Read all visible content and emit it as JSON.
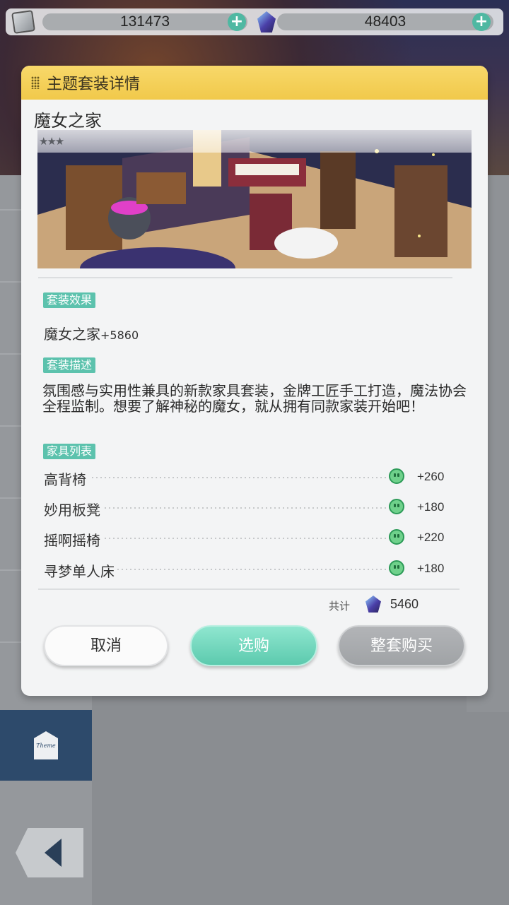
{
  "currency": {
    "coins": "131473",
    "crystals": "48403",
    "add_symbol": "+"
  },
  "dialog": {
    "title": "主题套装详情",
    "set_name": "魔女之家",
    "stars": "★★★",
    "sections": {
      "effect": "套装效果",
      "description": "套装描述",
      "furniture": "家具列表"
    },
    "effect": {
      "name": "魔女之家",
      "value": "+5860"
    },
    "description": "氛围感与实用性兼具的新款家具套装，金牌工匠手工打造，魔法协会全程监制。想要了解神秘的魔女，就从拥有同款家装开始吧！",
    "furniture": [
      {
        "name": "高背椅",
        "value": "+260"
      },
      {
        "name": "妙用板凳",
        "value": "+180"
      },
      {
        "name": "摇啊摇椅",
        "value": "+220"
      },
      {
        "name": "寻梦单人床",
        "value": "+180"
      }
    ],
    "total_label": "共计",
    "total_value": "5460",
    "buttons": {
      "cancel": "取消",
      "select": "选购",
      "buy_all": "整套购买"
    }
  },
  "sidebar": {
    "theme_tab_icon_text": "Theme"
  }
}
